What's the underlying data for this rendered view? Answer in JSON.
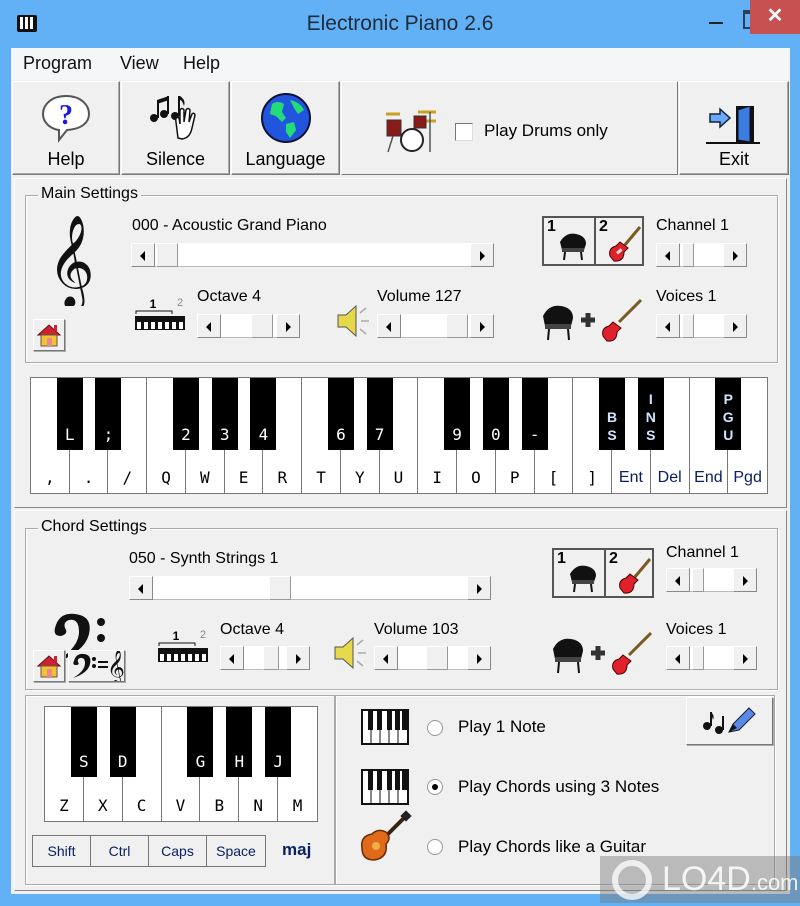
{
  "window": {
    "title": "Electronic Piano 2.6",
    "close_glyph": "✕"
  },
  "menu": [
    "Program",
    "View",
    "Help"
  ],
  "toolbar": {
    "help_label": "Help",
    "silence_label": "Silence",
    "language_label": "Language",
    "drums_label": "Play Drums only",
    "drums_checked": false,
    "exit_label": "Exit"
  },
  "main_settings": {
    "title": "Main Settings",
    "instrument": "000 - Acoustic Grand Piano",
    "instrument_value": 0,
    "instrument_max": 127,
    "octave_label": "Octave 4",
    "octave_value": 4,
    "volume_label": "Volume 127",
    "volume_value": 127,
    "channel_label": "Channel 1",
    "channel_box": [
      "1",
      "2"
    ],
    "voices_label": "Voices 1",
    "octave_icon_nums": [
      "1",
      "2"
    ]
  },
  "main_keyboard": {
    "white_keys": [
      ",",
      ".",
      "/",
      "Q",
      "W",
      "E",
      "R",
      "T",
      "Y",
      "U",
      "I",
      "O",
      "P",
      "[",
      "]",
      "Ent",
      "Del",
      "End",
      "Pgd"
    ],
    "black_keys": [
      {
        "after": 0,
        "label": "L"
      },
      {
        "after": 1,
        "label": ";"
      },
      {
        "after": 3,
        "label": "2"
      },
      {
        "after": 4,
        "label": "3"
      },
      {
        "after": 5,
        "label": "4"
      },
      {
        "after": 7,
        "label": "6"
      },
      {
        "after": 8,
        "label": "7"
      },
      {
        "after": 10,
        "label": "9"
      },
      {
        "after": 11,
        "label": "0"
      },
      {
        "after": 12,
        "label": "-"
      },
      {
        "after": 14,
        "label": "B\nS"
      },
      {
        "after": 15,
        "label": "I\nN\nS"
      },
      {
        "after": 17,
        "label": "P\nG\nU"
      }
    ]
  },
  "chord_settings": {
    "title": "Chord Settings",
    "instrument": "050 - Synth Strings 1",
    "instrument_value": 50,
    "instrument_max": 127,
    "octave_label": "Octave 4",
    "volume_label": "Volume 103",
    "volume_value": 103,
    "channel_label": "Channel 1",
    "channel_box": [
      "1",
      "2"
    ],
    "voices_label": "Voices 1",
    "octave_icon_nums": [
      "1",
      "2"
    ]
  },
  "chord_keyboard": {
    "white_keys": [
      "Z",
      "X",
      "C",
      "V",
      "B",
      "N",
      "M"
    ],
    "black_keys": [
      {
        "after": 0,
        "label": "S"
      },
      {
        "after": 1,
        "label": "D"
      },
      {
        "after": 3,
        "label": "G"
      },
      {
        "after": 4,
        "label": "H"
      },
      {
        "after": 5,
        "label": "J"
      }
    ],
    "modifiers": [
      "Shift",
      "Ctrl",
      "Caps",
      "Space"
    ],
    "chord_type": "maj"
  },
  "play_modes": [
    {
      "label": "Play 1 Note",
      "selected": false
    },
    {
      "label": "Play Chords using 3 Notes",
      "selected": true
    },
    {
      "label": "Play Chords like a Guitar",
      "selected": false
    }
  ],
  "watermark": {
    "text": "LO4D",
    "suffix": ".com"
  }
}
